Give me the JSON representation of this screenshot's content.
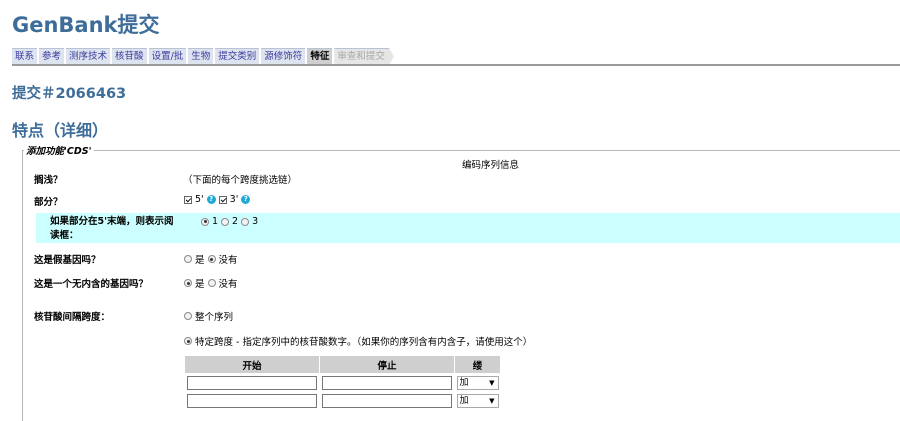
{
  "app_title": "GenBank提交",
  "tabs": [
    {
      "label": "联系",
      "state": "normal"
    },
    {
      "label": "参考",
      "state": "normal"
    },
    {
      "label": "测序技术",
      "state": "normal"
    },
    {
      "label": "核苷酸",
      "state": "normal"
    },
    {
      "label": "设置/批",
      "state": "normal"
    },
    {
      "label": "生物",
      "state": "normal"
    },
    {
      "label": "提交类别",
      "state": "normal"
    },
    {
      "label": "源修饰符",
      "state": "normal"
    },
    {
      "label": "特征",
      "state": "active"
    },
    {
      "label": "审查和提交",
      "state": "disabled"
    }
  ],
  "submission_id": "提交＃2066463",
  "section_title": "特点（详细）",
  "fieldset_legend": "添加功能'CDS'",
  "center_info": "编码序列信息",
  "fields": {
    "span_label": "搁浅？",
    "span_hint": "（下面的每个跨度挑选链）",
    "partial_label": "部分？",
    "partial_5": "5'",
    "partial_5_checked": true,
    "partial_3": "3'",
    "partial_3_checked": true,
    "help_glyph": "?",
    "frame_label": "如果部分在5'末端，则表示阅读框：",
    "frame_options": [
      "1",
      "2",
      "3"
    ],
    "frame_selected": "1",
    "pseudo_label": "这是假基因吗？",
    "pseudo_yes": "是",
    "pseudo_no": "没有",
    "pseudo_selected": "no",
    "intronless_label": "这是一个无内含的基因吗？",
    "intronless_yes": "是",
    "intronless_no": "没有",
    "intronless_selected": "yes",
    "nuc_span_label": "核苷酸间隔跨度：",
    "whole_seq": "整个序列",
    "specific_span": "特定跨度 - 指定序列中的核苷酸数字。（如果你的序列含有内含子，请使用这个）",
    "nuc_span_selected": "specific"
  },
  "span_table": {
    "headers": [
      "开始",
      "停止",
      "缕"
    ],
    "rows": [
      {
        "start": "",
        "stop": "",
        "strand": "加"
      },
      {
        "start": "",
        "stop": "",
        "strand": "加"
      }
    ],
    "dropdown_glyph": "▼"
  }
}
